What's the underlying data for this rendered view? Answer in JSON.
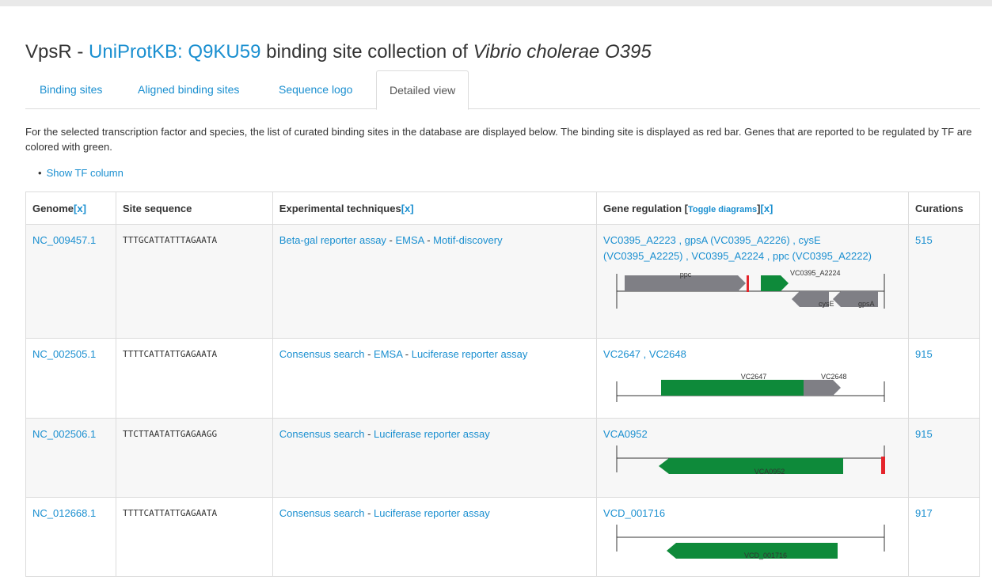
{
  "header": {
    "title_prefix": "VpsR - ",
    "title_link": "UniProtKB: Q9KU59",
    "title_mid": " binding site collection of ",
    "title_species": "Vibrio cholerae O395"
  },
  "tabs": [
    {
      "label": "Binding sites"
    },
    {
      "label": "Aligned binding sites"
    },
    {
      "label": "Sequence logo"
    },
    {
      "label": "Detailed view"
    }
  ],
  "description": "For the selected transcription factor and species, the list of curated binding sites in the database are displayed below. The binding site is displayed as red bar. Genes that are reported to be regulated by TF are colored with green.",
  "show_tf_column": "Show TF column",
  "table": {
    "headers": {
      "genome": "Genome",
      "genome_x": "[x]",
      "site": "Site sequence",
      "tech": "Experimental techniques",
      "tech_x": "[x]",
      "gene": "Gene regulation [",
      "gene_toggle": "Toggle diagrams",
      "gene_close": "]",
      "gene_x": "[x]",
      "curations": "Curations"
    },
    "sep": " - ",
    "rows": [
      {
        "genome": "NC_009457.1",
        "site": "TTTGCATTATTTAGAATA",
        "tech": [
          "Beta-gal reporter assay",
          "EMSA",
          "Motif-discovery"
        ],
        "gene_text": "VC0395_A2223 , gpsA (VC0395_A2226) , cysE (VC0395_A2225) , VC0395_A2224 , ppc (VC0395_A2222)",
        "diag_labels": [
          "ppc",
          "VC0395_A2224",
          "cysE",
          "gpsA"
        ],
        "curations": "515"
      },
      {
        "genome": "NC_002505.1",
        "site": "TTTTCATTATTGAGAATA",
        "tech": [
          "Consensus search",
          "EMSA",
          "Luciferase reporter assay"
        ],
        "gene_text": "VC2647 , VC2648",
        "diag_labels": [
          "VC2647",
          "VC2648"
        ],
        "curations": "915"
      },
      {
        "genome": "NC_002506.1",
        "site": "TTCTTAATATTGAGAAGG",
        "tech": [
          "Consensus search",
          "Luciferase reporter assay"
        ],
        "gene_text": "VCA0952",
        "diag_labels": [
          "VCA0952"
        ],
        "curations": "915"
      },
      {
        "genome": "NC_012668.1",
        "site": "TTTTCATTATTGAGAATA",
        "tech": [
          "Consensus search",
          "Luciferase reporter assay"
        ],
        "gene_text": "VCD_001716",
        "diag_labels": [
          "VCD_001716"
        ],
        "curations": "917"
      }
    ]
  },
  "colors": {
    "link": "#1a8fd0",
    "regulated_gene": "#0e8a3a",
    "other_gene": "#7f7f85",
    "binding_site": "#e5242b"
  }
}
